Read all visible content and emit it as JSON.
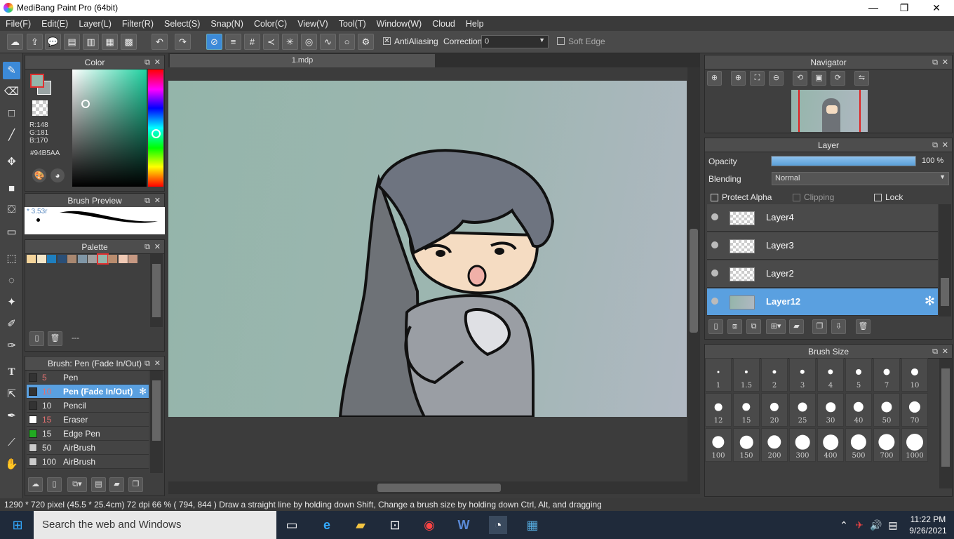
{
  "window": {
    "title": "MediBang Paint Pro (64bit)",
    "minimize": "—",
    "maximize": "❐",
    "close": "✕"
  },
  "menu": [
    "File(F)",
    "Edit(E)",
    "Layer(L)",
    "Filter(R)",
    "Select(S)",
    "Snap(N)",
    "Color(C)",
    "View(V)",
    "Tool(T)",
    "Window(W)",
    "Cloud",
    "Help"
  ],
  "toolbar": {
    "antialias_label": "AntiAliasing",
    "antialias_checked": "✕",
    "correction_label": "Correction",
    "correction_value": "0",
    "softedge_label": "Soft Edge"
  },
  "color_panel": {
    "title": "Color",
    "r": "R:148",
    "g": "G:181",
    "b": "B:170",
    "hex": "#94B5AA",
    "current": "#94b5aa"
  },
  "brush_preview": {
    "title": "Brush Preview",
    "size": "* 3.53r"
  },
  "palette": {
    "title": "Palette",
    "colors": [
      "#f4d49a",
      "#f3e6c8",
      "#1e7fbf",
      "#2a4f77",
      "#a88770",
      "#7f96a6",
      "#a0a0a0",
      "#94b5aa",
      "#b98c6e",
      "#f0c9b4",
      "#c69882"
    ],
    "footer_text": "---"
  },
  "brush_list": {
    "title": "Brush: Pen (Fade In/Out)",
    "items": [
      {
        "size": "5",
        "name": "Pen",
        "swatch": "#333333"
      },
      {
        "size": "10",
        "name": "Pen (Fade In/Out)",
        "swatch": "#333333"
      },
      {
        "size": "10",
        "name": "Pencil",
        "swatch": "#333333"
      },
      {
        "size": "15",
        "name": "Eraser",
        "swatch": "#ffffff"
      },
      {
        "size": "15",
        "name": "Edge Pen",
        "swatch": "#22aa22"
      },
      {
        "size": "50",
        "name": "AirBrush",
        "swatch": "#cccccc"
      },
      {
        "size": "100",
        "name": "AirBrush",
        "swatch": "#cccccc"
      }
    ]
  },
  "document": {
    "tab": "1.mdp"
  },
  "navigator": {
    "title": "Navigator"
  },
  "layer_panel": {
    "title": "Layer",
    "opacity_label": "Opacity",
    "opacity_value": "100 %",
    "opacity_fraction": 1.0,
    "blending_label": "Blending",
    "blending_value": "Normal",
    "protect_alpha": "Protect Alpha",
    "clipping": "Clipping",
    "lock": "Lock",
    "layers": [
      "Layer4",
      "Layer3",
      "Layer2",
      "Layer12"
    ]
  },
  "brush_size": {
    "title": "Brush Size",
    "sizes": [
      "1",
      "1.5",
      "2",
      "3",
      "4",
      "5",
      "7",
      "10",
      "12",
      "15",
      "20",
      "25",
      "30",
      "40",
      "50",
      "70",
      "100",
      "150",
      "200",
      "300",
      "400",
      "500",
      "700",
      "1000"
    ]
  },
  "status": {
    "text": "1290 * 720 pixel   (45.5 * 25.4cm)   72 dpi   66 %   ( 794, 844 )   Draw a straight line by holding down Shift, Change a brush size by holding down Ctrl, Alt, and dragging"
  },
  "taskbar": {
    "search_placeholder": "Search the web and Windows",
    "time": "11:22 PM",
    "date": "9/26/2021"
  }
}
